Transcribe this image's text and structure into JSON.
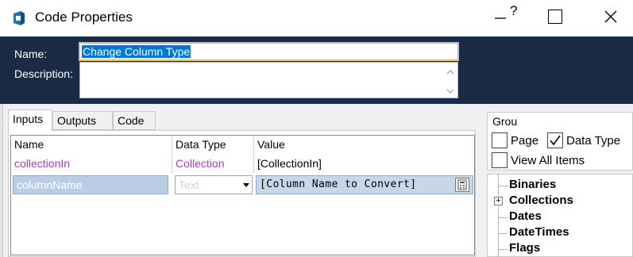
{
  "window": {
    "title": "Code Properties",
    "help_label": "?"
  },
  "header": {
    "name_label": "Name:",
    "name_value": "Change Column Type",
    "description_label": "Description:",
    "description_value": ""
  },
  "tabs": [
    {
      "label": "Inputs",
      "active": true
    },
    {
      "label": "Outputs",
      "active": false
    },
    {
      "label": "Code",
      "active": false
    }
  ],
  "grid": {
    "columns": [
      "Name",
      "Data Type",
      "Value"
    ],
    "rows": [
      {
        "name": "collectionIn",
        "type": "Collection",
        "value": "[CollectionIn]"
      }
    ],
    "edit_row": {
      "name": "columnName",
      "type": "Text",
      "value": "[Column Name to Convert]"
    }
  },
  "group_panel": {
    "title": "Grou",
    "options": [
      {
        "label": "Page",
        "checked": false
      },
      {
        "label": "Data Type",
        "checked": true
      },
      {
        "label": "View All Items",
        "checked": false
      }
    ]
  },
  "tree": {
    "items": [
      {
        "label": "Binaries",
        "expandable": false
      },
      {
        "label": "Collections",
        "expandable": true
      },
      {
        "label": "Dates",
        "expandable": false
      },
      {
        "label": "DateTimes",
        "expandable": false
      },
      {
        "label": "Flags",
        "expandable": false
      }
    ]
  },
  "colors": {
    "header_bg": "#1b2b45",
    "selection": "#0078d7",
    "purple_text": "#a43fb7",
    "edit_row_bg": "#b9cde8"
  }
}
